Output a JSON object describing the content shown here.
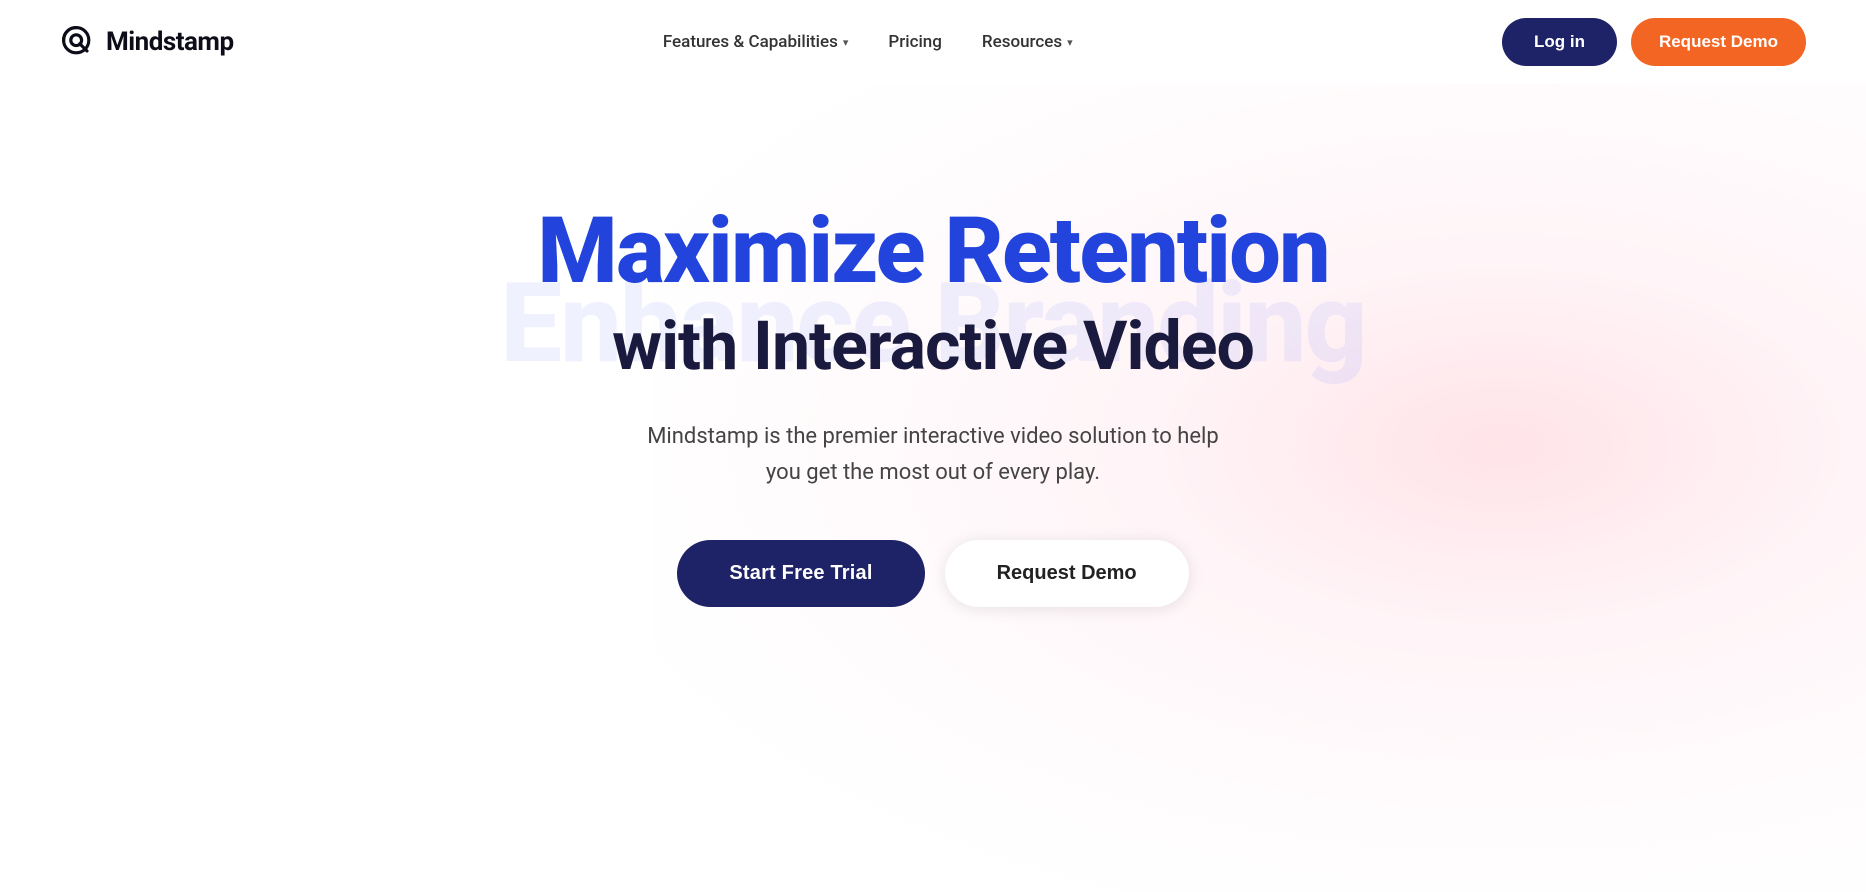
{
  "logo": {
    "text": "Mindstamp"
  },
  "nav": {
    "links": [
      {
        "id": "features",
        "label": "Features & Capabilities",
        "hasDropdown": true
      },
      {
        "id": "pricing",
        "label": "Pricing",
        "hasDropdown": false
      },
      {
        "id": "resources",
        "label": "Resources",
        "hasDropdown": true
      }
    ],
    "login_label": "Log in",
    "request_demo_label": "Request Demo"
  },
  "hero": {
    "bg_text": "Enhance Branding",
    "title_main": "Maximize Retention",
    "title_sub": "with Interactive Video",
    "description": "Mindstamp is the premier interactive video solution to help you get the most out of every play.",
    "btn_trial": "Start Free Trial",
    "btn_demo": "Request Demo"
  }
}
